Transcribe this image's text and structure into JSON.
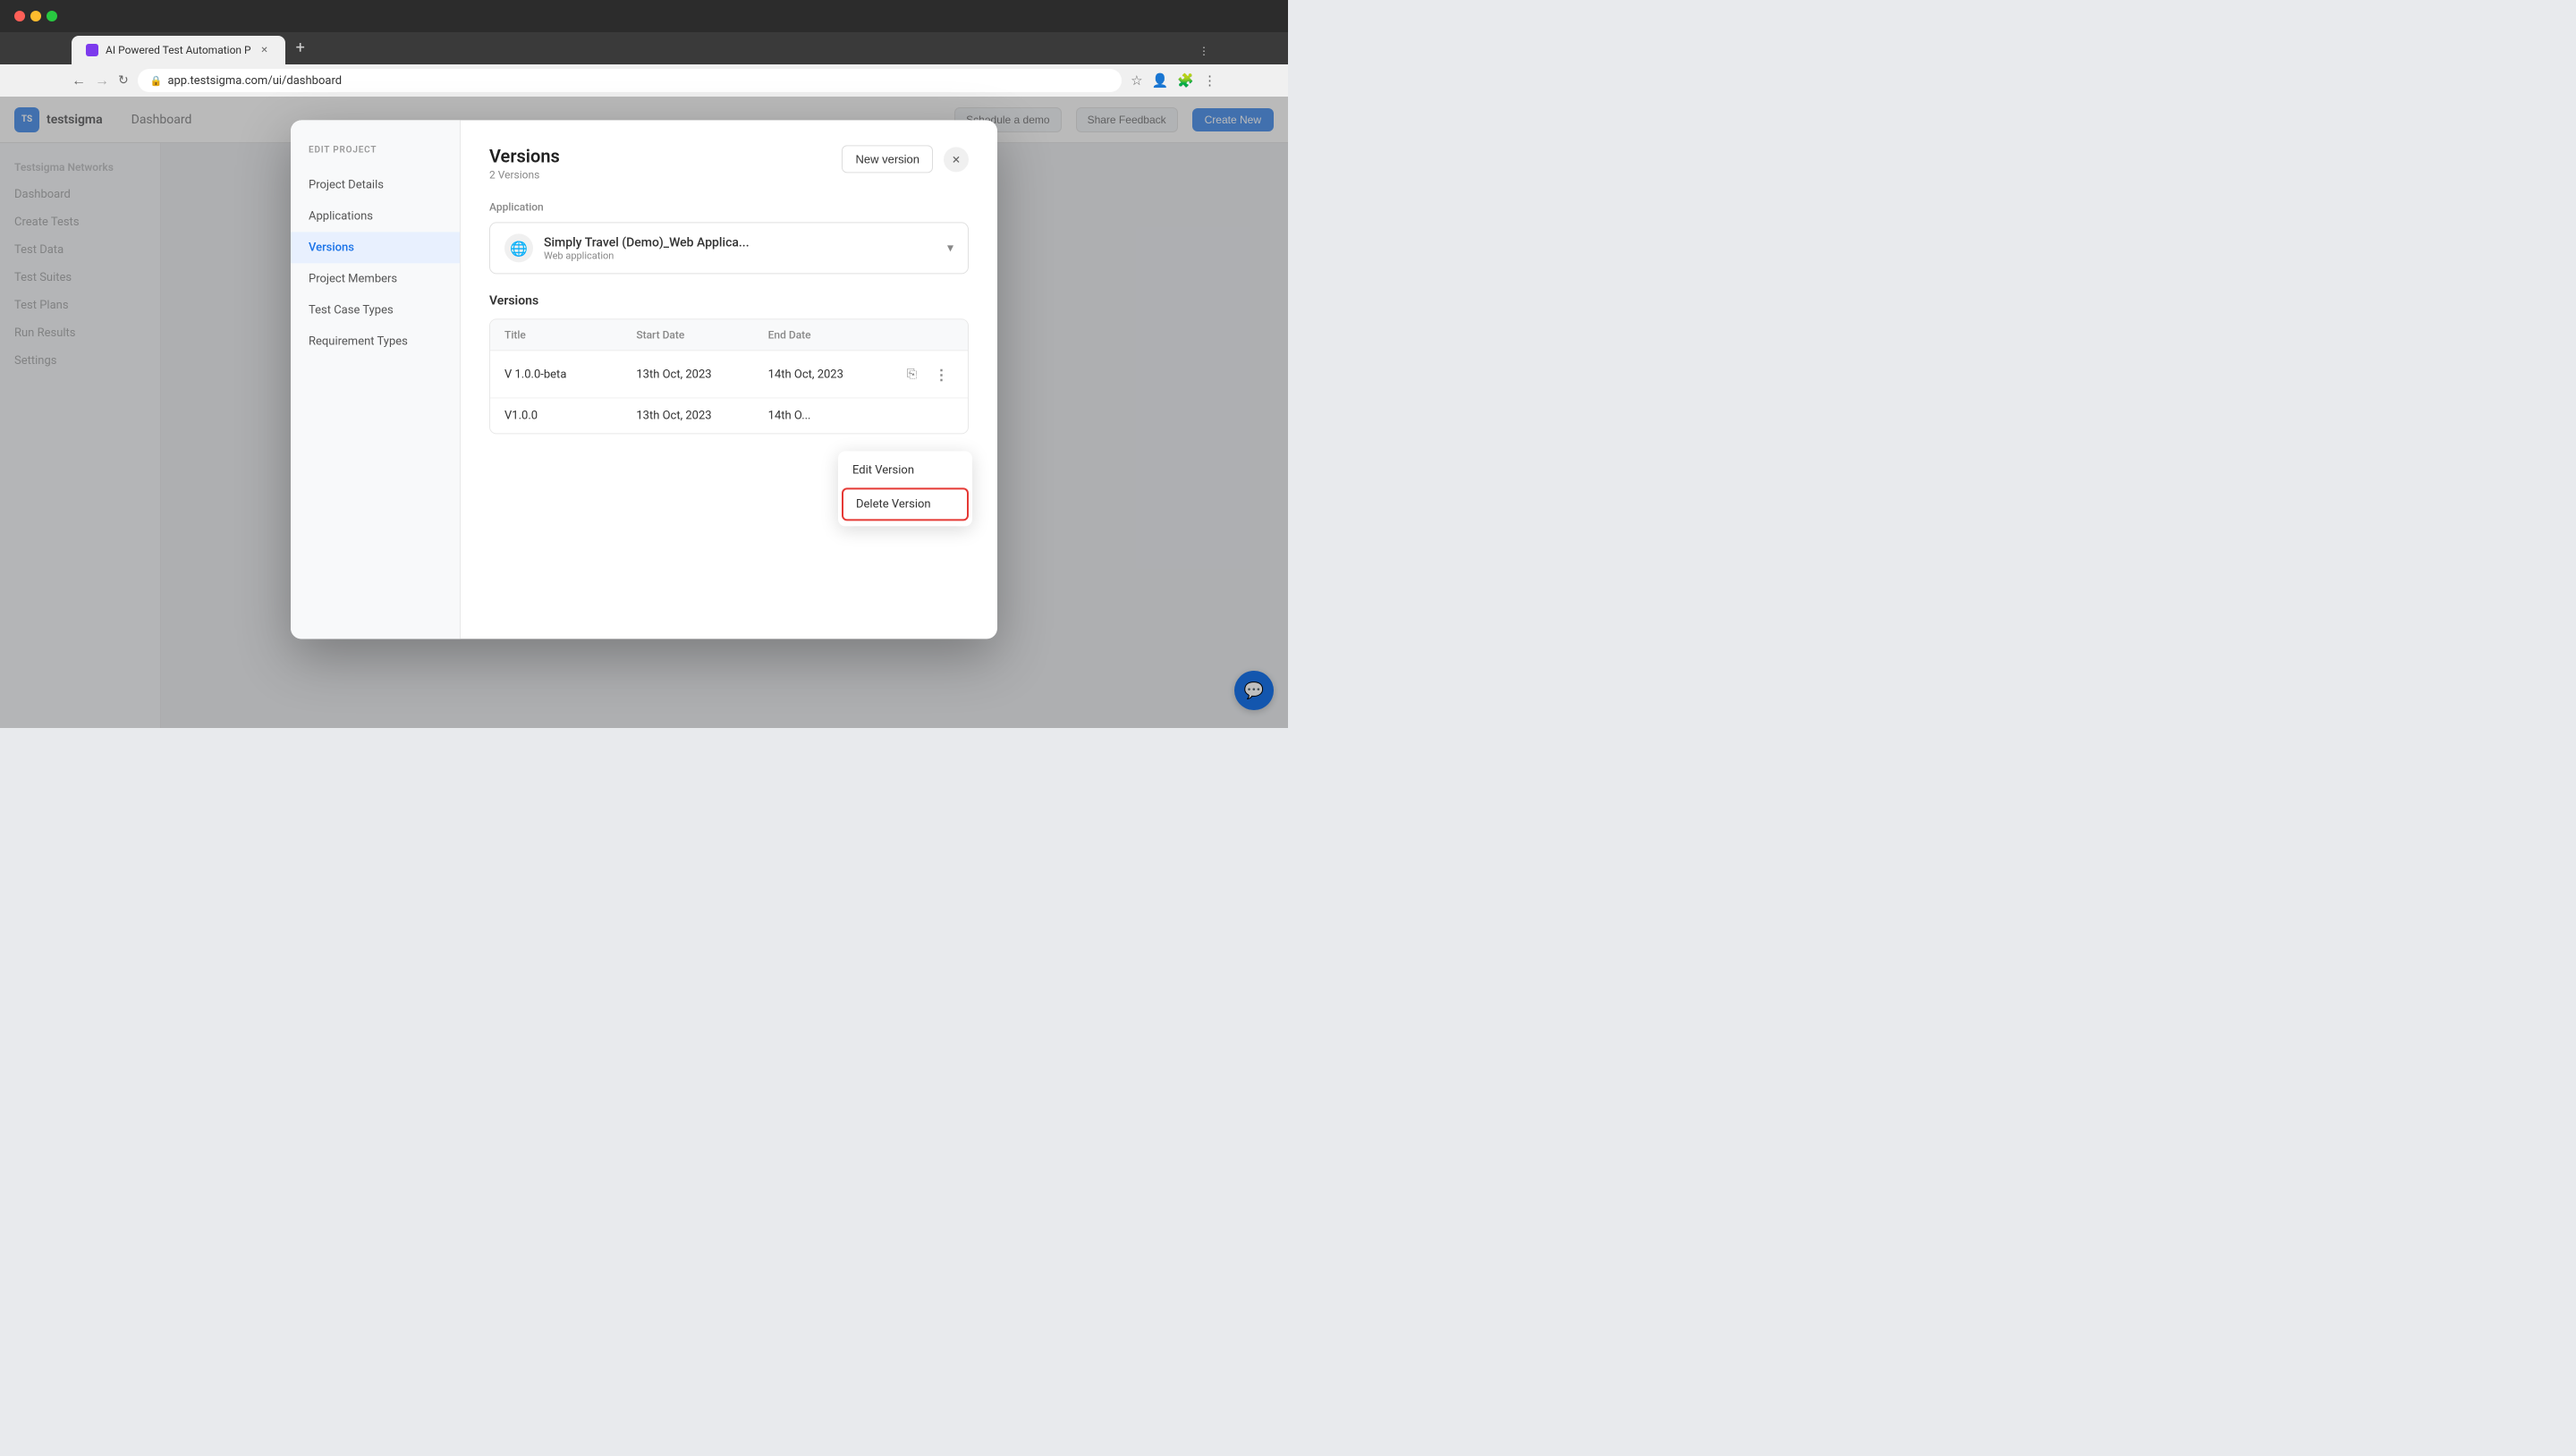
{
  "browser": {
    "tab_title": "AI Powered Test Automation P",
    "address": "app.testsigma.com/ui/dashboard",
    "new_tab_label": "+"
  },
  "app": {
    "logo_text": "testsigma",
    "header_breadcrumb": "Dashboard",
    "schedule_demo_label": "Schedule a demo",
    "share_feedback_label": "Share Feedback",
    "create_new_label": "Create New"
  },
  "sidebar": {
    "items": [
      {
        "label": "Testsigma Networks"
      },
      {
        "label": "Dashboard"
      },
      {
        "label": "Create Tests"
      },
      {
        "label": "Test Data"
      },
      {
        "label": "Test Suites"
      },
      {
        "label": "Test Plans"
      },
      {
        "label": "Run Results"
      },
      {
        "label": "Settings"
      }
    ]
  },
  "modal": {
    "edit_project_label": "EDIT PROJECT",
    "nav_items": [
      {
        "label": "Project Details",
        "active": false
      },
      {
        "label": "Applications",
        "active": false
      },
      {
        "label": "Versions",
        "active": true
      },
      {
        "label": "Project Members",
        "active": false
      },
      {
        "label": "Test Case Types",
        "active": false
      },
      {
        "label": "Requirement Types",
        "active": false
      }
    ],
    "title": "Versions",
    "subtitle": "2 Versions",
    "new_version_label": "New version",
    "close_label": "×",
    "application_section_label": "Application",
    "app_name": "Simply Travel (Demo)_Web Applica...",
    "app_type": "Web application",
    "versions_section_label": "Versions",
    "table_headers": [
      {
        "label": "Title"
      },
      {
        "label": "Start Date"
      },
      {
        "label": "End Date"
      }
    ],
    "versions": [
      {
        "title": "V 1.0.0-beta",
        "start_date": "13th Oct, 2023",
        "end_date": "14th Oct, 2023"
      },
      {
        "title": "V1.0.0",
        "start_date": "13th Oct, 2023",
        "end_date": "14th O..."
      }
    ],
    "context_menu": {
      "edit_label": "Edit Version",
      "delete_label": "Delete Version"
    }
  }
}
